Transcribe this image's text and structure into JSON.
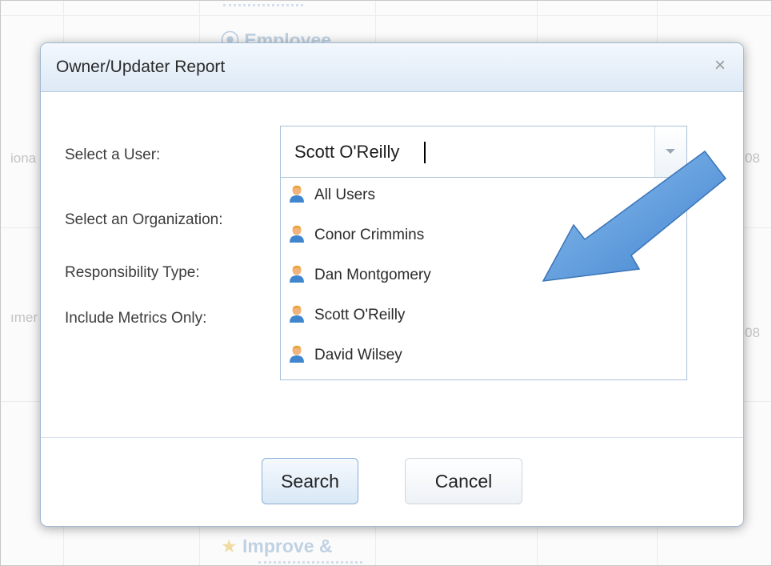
{
  "background": {
    "top_heading": "Employee",
    "bottom_heading": "Improve &",
    "left_fragments": [
      "iona",
      "ımer"
    ],
    "right_fragments": [
      "08",
      "08"
    ]
  },
  "dialog": {
    "title": "Owner/Updater Report",
    "close_label": "×",
    "labels": {
      "select_user": "Select a User:",
      "select_org": "Select an Organization:",
      "responsibility": "Responsibility Type:",
      "metrics_only": "Include Metrics Only:"
    },
    "user_field": {
      "value": "Scott O'Reilly"
    },
    "user_options": [
      {
        "label": "All Users",
        "icon": "user-icon"
      },
      {
        "label": "Conor Crimmins",
        "icon": "user-icon"
      },
      {
        "label": "Dan Montgomery",
        "icon": "user-icon"
      },
      {
        "label": "Scott O'Reilly",
        "icon": "user-icon"
      },
      {
        "label": "David Wilsey",
        "icon": "user-icon"
      }
    ],
    "buttons": {
      "search": "Search",
      "cancel": "Cancel"
    }
  },
  "colors": {
    "header_bg": "#dde9f5",
    "accent_border": "#9fb8d2",
    "arrow_fill": "#5b9bdc"
  }
}
